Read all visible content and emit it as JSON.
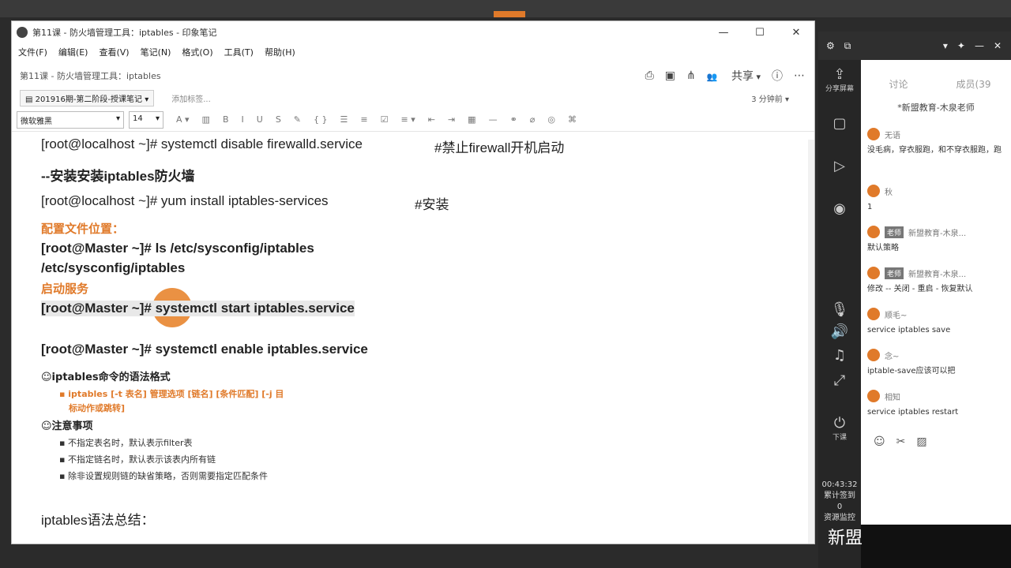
{
  "window": {
    "title": "第11课 - 防火墙管理工具：iptables - 印象笔记",
    "controls": [
      "—",
      "☐",
      "✕"
    ]
  },
  "menu": [
    "文件(F)",
    "编辑(E)",
    "查看(V)",
    "笔记(N)",
    "格式(O)",
    "工具(T)",
    "帮助(H)"
  ],
  "note": {
    "title": "第11课 - 防火墙管理工具：iptables",
    "share": "共享",
    "notebook": "201916期-第二阶段-授课笔记",
    "tag_placeholder": "添加标签...",
    "time": "3 分钟前"
  },
  "format": {
    "font": "微软雅黑",
    "size": "14"
  },
  "content": {
    "l1": "[root@localhost ~]# systemctl disable firewalld.service",
    "l1c": "#禁止firewall开机启动",
    "l2": "--安装安装iptables防火墙",
    "l3": "[root@localhost ~]# yum install iptables-services",
    "l3c": "#安装",
    "l4": "配置文件位置：",
    "l5": "[root@Master ~]# ls /etc/sysconfig/iptables",
    "l6": "/etc/sysconfig/iptables",
    "l7": "启动服务",
    "l8": "[root@Master ~]# systemctl start iptables.service",
    "l9": "[root@Master ~]# systemctl enable iptables.service",
    "l10": "☺iptables命令的语法格式",
    "l11": "▪ iptables [-t 表名] 管理选项 [链名] [条件匹配] [-j 目",
    "l11b": "标动作或跳转]",
    "l12": "☺注意事项",
    "l13": "▪ 不指定表名时，默认表示filter表",
    "l14": "▪ 不指定链名时，默认表示该表内所有链",
    "l15": "▪ 除非设置规则链的缺省策略，否则需要指定匹配条件",
    "l16": "iptables语法总结："
  },
  "panel": {
    "share_screen": "分享屏幕",
    "tab_discuss": "讨论",
    "tab_members": "成员(39",
    "teacher": "*新盟教育-木泉老师",
    "end_class": "下课",
    "timer": "00:43:32",
    "stat1": "累计签到",
    "stat1v": "0",
    "stat2": "资源监控",
    "messages": [
      {
        "name": "无语",
        "text": "没毛病，穿衣服跑，和不穿衣服跑，跑"
      },
      {
        "name": "秋",
        "text": "1"
      },
      {
        "name": "新盟教育-木泉...",
        "badge": "老师",
        "text": "默认策略"
      },
      {
        "name": "新盟教育-木泉...",
        "badge": "老师",
        "text": "修改 -- 关闭 - 重启 - 恢复默认"
      },
      {
        "name": "顺毛~",
        "text": "service iptables save"
      },
      {
        "name": "念~",
        "text": "iptable-save应该可以把"
      },
      {
        "name": "相知",
        "text": "service iptables restart"
      }
    ],
    "watermark": "新盟"
  }
}
